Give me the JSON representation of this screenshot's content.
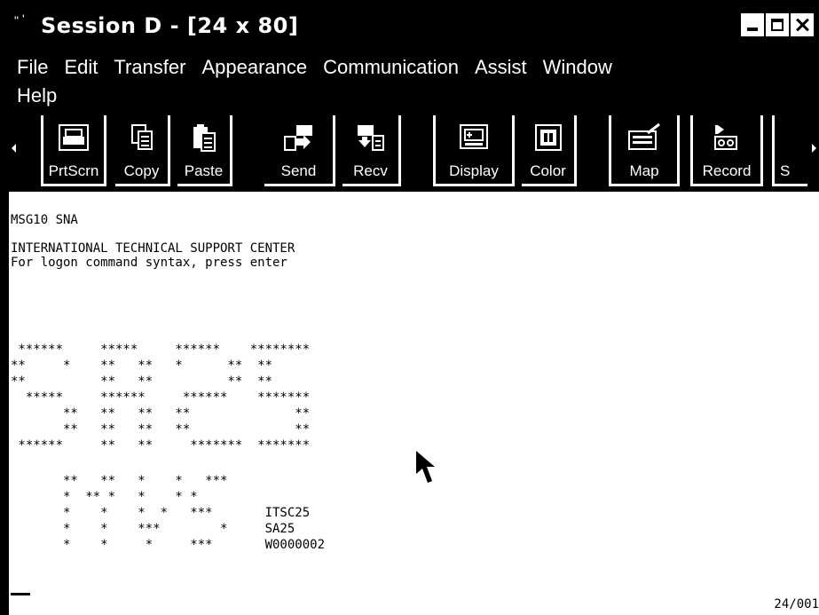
{
  "window": {
    "title": "Session D - [24 x 80]"
  },
  "menu": {
    "file": "File",
    "edit": "Edit",
    "transfer": "Transfer",
    "appearance": "Appearance",
    "communication": "Communication",
    "assist": "Assist",
    "window": "Window",
    "help": "Help"
  },
  "toolbar": {
    "prtscrn": "PrtScrn",
    "copy": "Copy",
    "paste": "Paste",
    "send": "Send",
    "recv": "Recv",
    "display": "Display",
    "color": "Color",
    "map": "Map",
    "record": "Record",
    "partial": "S"
  },
  "terminal": {
    "lines": [
      "MSG10 SNA",
      "",
      "INTERNATIONAL TECHNICAL SUPPORT CENTER",
      "For logon command syntax, press enter",
      "",
      "",
      "",
      "",
      " ******     *****     ******    ********",
      "**     *    **   **   *      **  **",
      "**          **   **          **  **",
      "  *****     ******     ******    *******",
      "       **   **   **   **              **",
      "       **   **   **   **              **",
      " ******     **   **     *******  *******",
      "",
      "       **   **   *    *   ***",
      "       *  ** *   *    * *",
      "       *    *    *  *   ***       ITSC25",
      "       *    *    ***        *     SA25",
      "       *    *     *     ***       W0000002"
    ],
    "position": "24/001"
  },
  "icons": [
    "printer-icon",
    "copy-icon",
    "paste-icon",
    "send-icon",
    "receive-icon",
    "display-icon",
    "color-icon",
    "map-icon",
    "record-icon"
  ],
  "colors": {
    "background": "#000000",
    "terminal": "#ffffff",
    "text": "#000000"
  }
}
